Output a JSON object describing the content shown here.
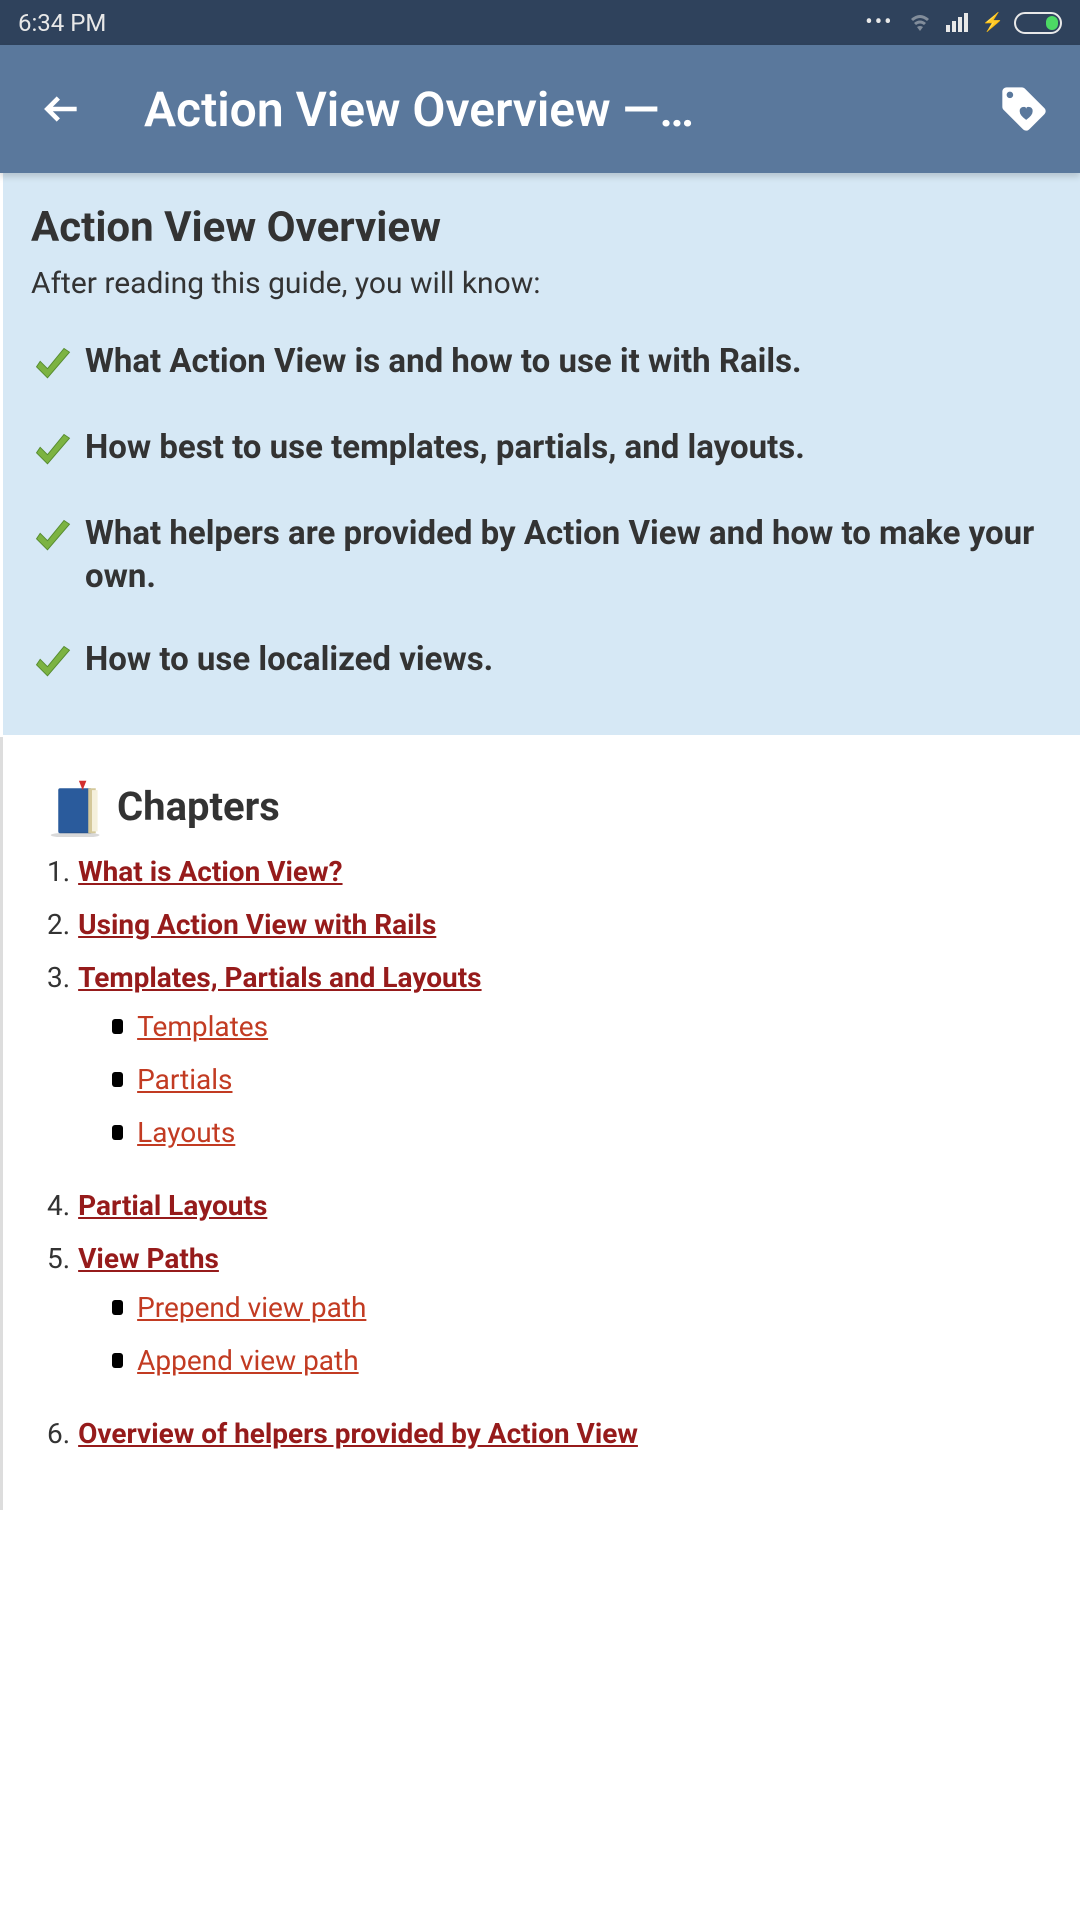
{
  "status": {
    "time": "6:34 PM"
  },
  "appbar": {
    "title": "Action View Overview —…"
  },
  "intro": {
    "heading": "Action View Overview",
    "lead": "After reading this guide, you will know:",
    "bullets": [
      "What Action View is and how to use it with Rails.",
      "How best to use templates, partials, and layouts.",
      "What helpers are provided by Action View and how to make your own.",
      "How to use localized views."
    ]
  },
  "chapters": {
    "title": "Chapters",
    "items": [
      {
        "num": "1.",
        "label": "What is Action View?",
        "subs": []
      },
      {
        "num": "2.",
        "label": "Using Action View with Rails",
        "subs": []
      },
      {
        "num": "3.",
        "label": "Templates, Partials and Layouts",
        "subs": [
          "Templates",
          "Partials",
          "Layouts"
        ]
      },
      {
        "num": "4.",
        "label": "Partial Layouts",
        "subs": []
      },
      {
        "num": "5.",
        "label": "View Paths",
        "subs": [
          "Prepend view path",
          "Append view path"
        ]
      },
      {
        "num": "6.",
        "label": "Overview of helpers provided by Action View",
        "subs": []
      }
    ]
  }
}
